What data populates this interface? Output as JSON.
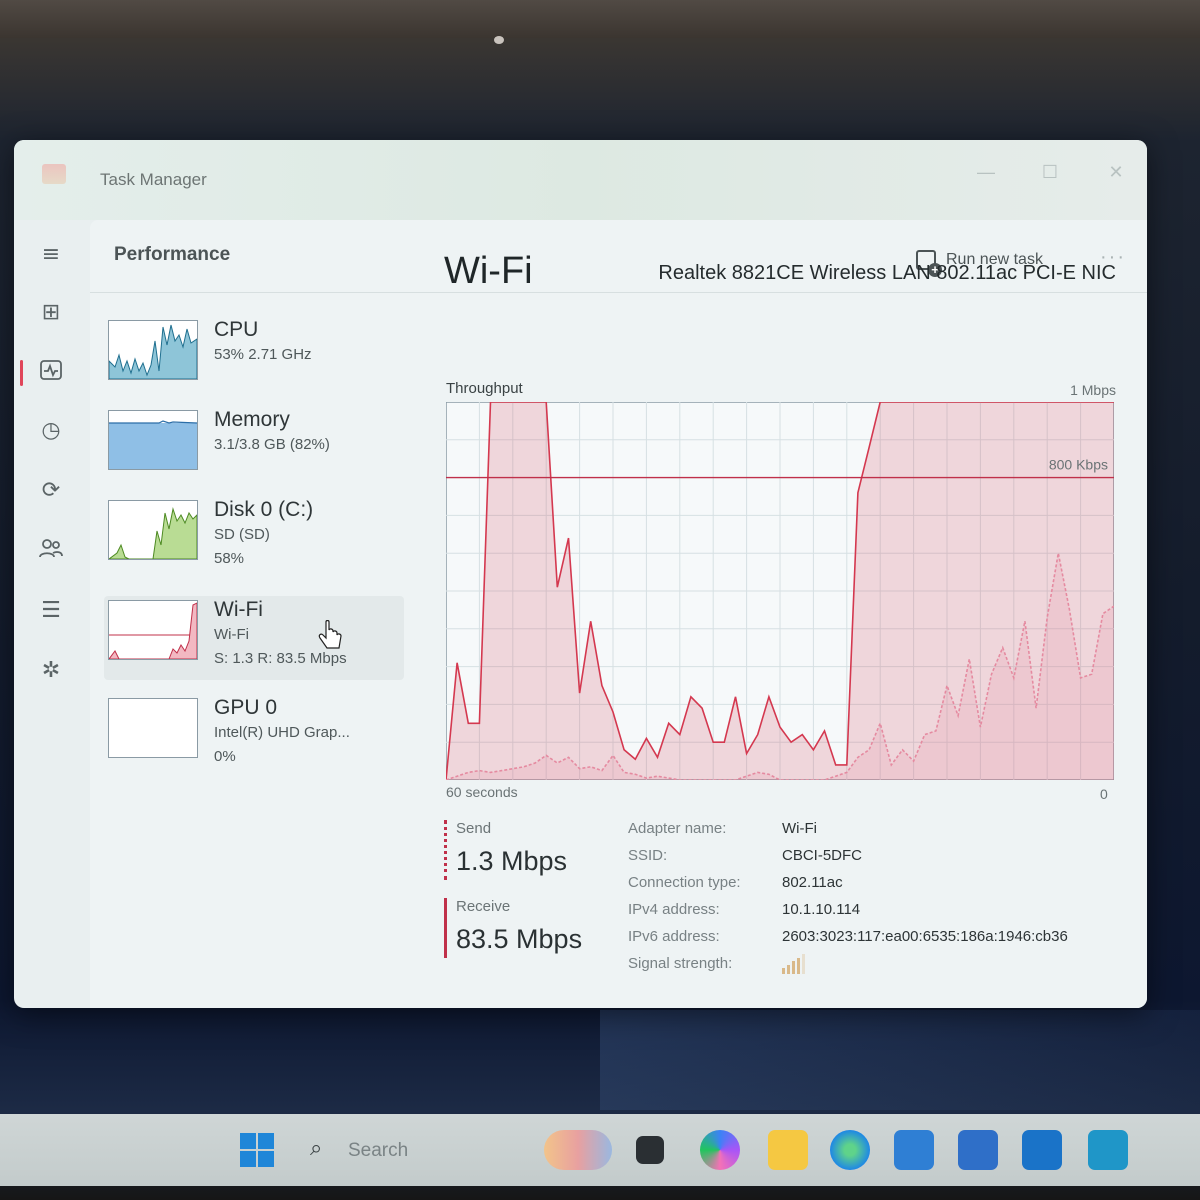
{
  "window": {
    "title": "Task Manager"
  },
  "controls": {
    "minimize": "—",
    "maximize": "☐",
    "close": "✕"
  },
  "header": {
    "page_title": "Performance",
    "run_new_task": "Run new task",
    "more": "···"
  },
  "nav_icons": [
    "hamburger-icon",
    "processes-icon",
    "performance-icon",
    "app-history-icon",
    "startup-apps-icon",
    "users-icon",
    "details-icon",
    "services-icon",
    "settings-icon"
  ],
  "devices": [
    {
      "name": "CPU",
      "line2": "53% 2.71 GHz",
      "line3": ""
    },
    {
      "name": "Memory",
      "line2": "3.1/3.8 GB (82%)",
      "line3": ""
    },
    {
      "name": "Disk 0 (C:)",
      "line2": "SD (SD)",
      "line3": "58%"
    },
    {
      "name": "Wi-Fi",
      "line2": "Wi-Fi",
      "line3": "S: 1.3 R: 83.5 Mbps"
    },
    {
      "name": "GPU 0",
      "line2": "Intel(R) UHD Grap...",
      "line3": "0%"
    }
  ],
  "detail": {
    "title": "Wi-Fi",
    "adapter": "Realtek 8821CE Wireless LAN 802.11ac PCI-E NIC",
    "throughput_label": "Throughput",
    "y_max": "1 Mbps",
    "x_left": "60 seconds",
    "x_right": "0",
    "scale_line_label": "800 Kbps",
    "send_label": "Send",
    "send_value": "1.3 Mbps",
    "receive_label": "Receive",
    "receive_value": "83.5 Mbps",
    "info": [
      {
        "key": "Adapter name:",
        "value": "Wi-Fi"
      },
      {
        "key": "SSID:",
        "value": "CBCI-5DFC"
      },
      {
        "key": "Connection type:",
        "value": "802.11ac"
      },
      {
        "key": "IPv4 address:",
        "value": "10.1.10.114"
      },
      {
        "key": "IPv6 address:",
        "value": "2603:3023:117:ea00:6535:186a:1946:cb36"
      },
      {
        "key": "Signal strength:",
        "value": ""
      }
    ],
    "signal_bars_lit": 4
  },
  "chart_data": {
    "type": "area",
    "title": "Throughput",
    "x_range": [
      60,
      0
    ],
    "y_range": [
      0,
      1000
    ],
    "y_unit": "Kbps",
    "reference_line": 800,
    "series": [
      {
        "name": "Receive",
        "color": "#d4384f",
        "values": [
          0,
          310,
          150,
          150,
          1000,
          1000,
          1000,
          1000,
          1000,
          1000,
          510,
          640,
          230,
          420,
          250,
          180,
          80,
          55,
          110,
          60,
          150,
          120,
          220,
          190,
          100,
          100,
          220,
          70,
          120,
          220,
          140,
          100,
          120,
          80,
          130,
          40,
          40,
          760,
          880,
          1000,
          1000,
          1000,
          1000,
          1000,
          1000,
          1000,
          1000,
          1000,
          1000,
          1000,
          1000,
          1000,
          1000,
          1000,
          1000,
          1000,
          1000,
          1000,
          1000,
          1000,
          1000
        ]
      },
      {
        "name": "Send",
        "color": "#e58aa0",
        "values": [
          0,
          10,
          20,
          25,
          20,
          25,
          30,
          35,
          45,
          65,
          45,
          60,
          30,
          35,
          25,
          65,
          20,
          15,
          5,
          10,
          5,
          0,
          0,
          0,
          0,
          0,
          0,
          10,
          20,
          15,
          0,
          0,
          0,
          0,
          0,
          10,
          20,
          60,
          80,
          150,
          40,
          80,
          50,
          120,
          130,
          250,
          170,
          320,
          140,
          280,
          350,
          270,
          420,
          190,
          430,
          600,
          450,
          270,
          280,
          440,
          460
        ]
      }
    ]
  },
  "taskbar": {
    "search_placeholder": "Search"
  }
}
